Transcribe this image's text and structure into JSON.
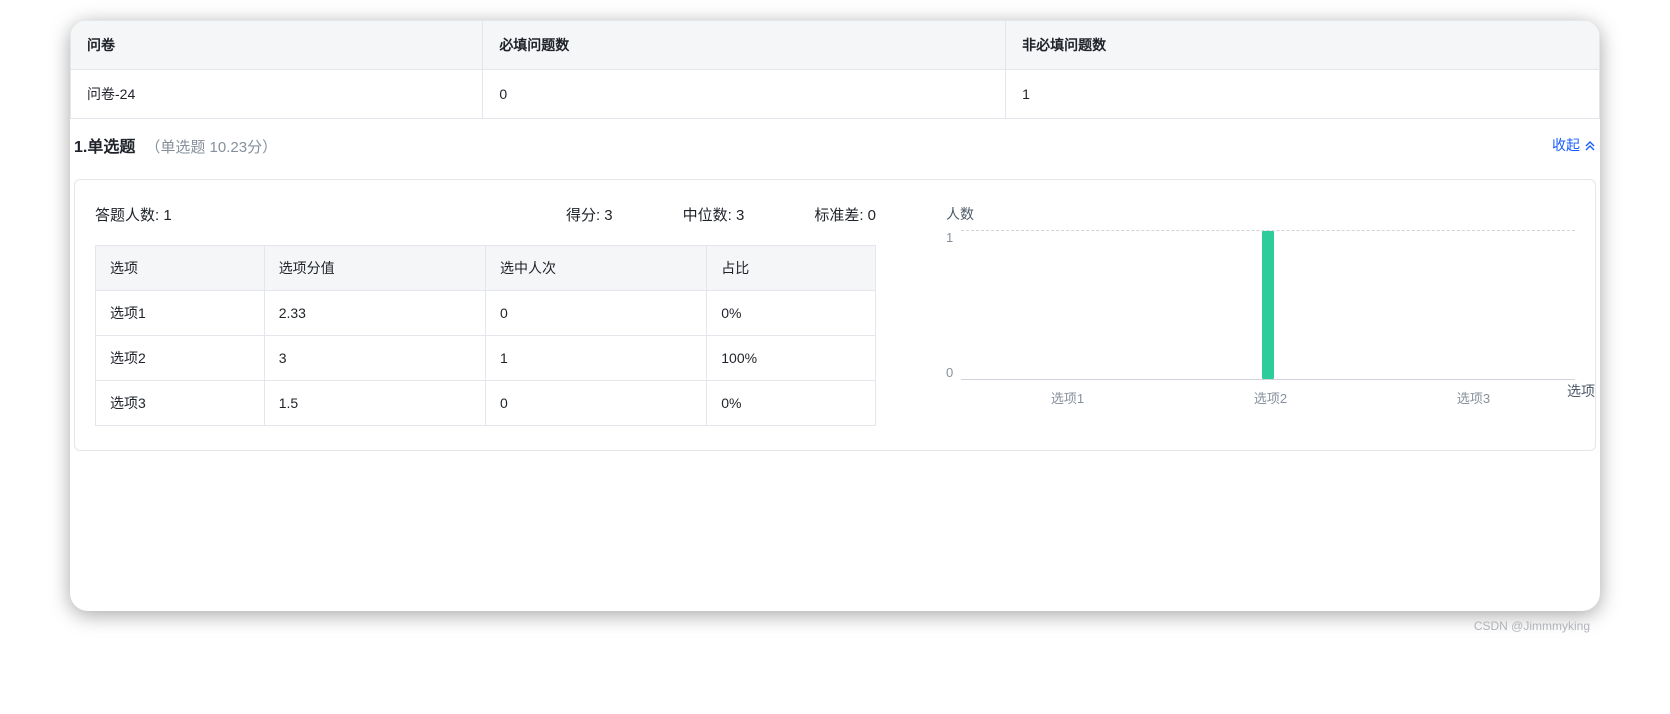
{
  "summary_table": {
    "headers": [
      "问卷",
      "必填问题数",
      "非必填问题数"
    ],
    "row": [
      "问卷-24",
      "0",
      "1"
    ]
  },
  "question": {
    "title": "1.单选题",
    "subtitle": "（单选题 10.23分）",
    "collapse_label": "收起"
  },
  "stats": {
    "answers_label": "答题人数: 1",
    "score_label": "得分: 3",
    "median_label": "中位数: 3",
    "stddev_label": "标准差: 0"
  },
  "options_table": {
    "headers": [
      "选项",
      "选项分值",
      "选中人次",
      "占比"
    ],
    "rows": [
      [
        "选项1",
        "2.33",
        "0",
        "0%"
      ],
      [
        "选项2",
        "3",
        "1",
        "100%"
      ],
      [
        "选项3",
        "1.5",
        "0",
        "0%"
      ]
    ]
  },
  "chart_data": {
    "type": "bar",
    "categories": [
      "选项1",
      "选项2",
      "选项3"
    ],
    "values": [
      0,
      1,
      0
    ],
    "ylabel": "人数",
    "xlabel": "选项",
    "ylim": [
      0,
      1
    ],
    "y_ticks": [
      "1",
      "0"
    ],
    "bar_color": "#2ecc9b"
  },
  "watermark": "CSDN @Jimmmyking"
}
